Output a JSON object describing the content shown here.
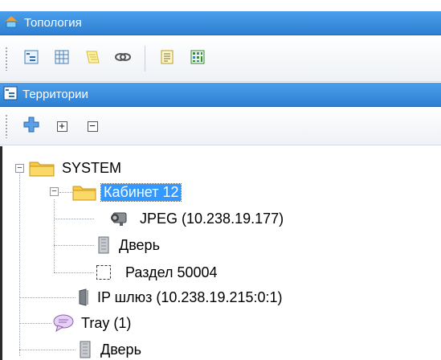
{
  "panel_top": {
    "title": "Топология",
    "icon": "topology-icon",
    "toolbar_icons": [
      "tree-view-icon",
      "grid-view-icon",
      "notes-icon",
      "link-icon",
      "report-icon",
      "map-icon"
    ]
  },
  "panel_territories": {
    "title": "Территории",
    "icon": "territories-icon",
    "toolbar": {
      "add_icon": "add-icon",
      "expand_all": "+",
      "collapse_all": "−"
    }
  },
  "tree": {
    "root": {
      "label": "SYSTEM",
      "icon": "folder-icon",
      "expander": "−"
    },
    "cabinet": {
      "label": "Кабинет 12",
      "icon": "folder-icon",
      "expander": "−",
      "selected": true
    },
    "camera": {
      "label": "JPEG (10.238.19.177)",
      "icon": "camera-icon"
    },
    "door1": {
      "label": "Дверь",
      "icon": "door-icon"
    },
    "section": {
      "label": "Раздел 50004",
      "icon": "section-icon"
    },
    "gateway": {
      "label": "IP шлюз (10.238.19.215:0:1)",
      "icon": "gateway-icon"
    },
    "tray": {
      "label": "Tray (1)",
      "icon": "tray-icon"
    },
    "door2": {
      "label": "Дверь",
      "icon": "door-icon"
    }
  },
  "colors": {
    "header_blue": "#2e7fd3",
    "selection_blue": "#3399ff",
    "folder_yellow": "#f7c948"
  }
}
